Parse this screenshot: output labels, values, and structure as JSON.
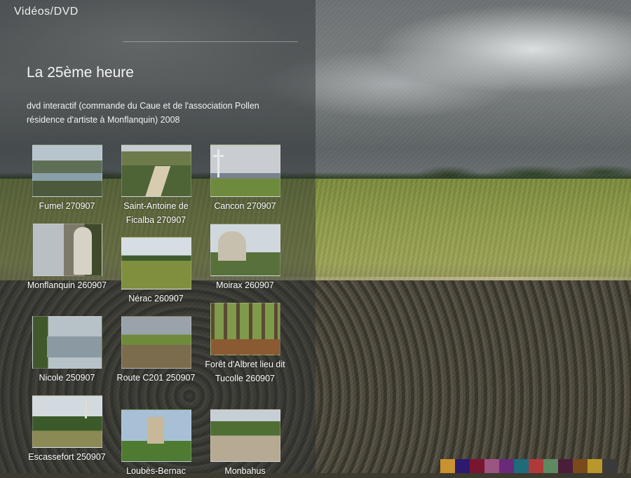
{
  "section": {
    "title": "Vidéos/DVD"
  },
  "page": {
    "title": "La 25ème heure",
    "description": "dvd interactif (commande du Caue et de l'association Pollen résidence d'artiste à Monflanquin) 2008"
  },
  "thumbnails": [
    {
      "caption": "Fumel 270907"
    },
    {
      "caption": "Saint-Antoine de Ficalba 270907"
    },
    {
      "caption": "Cancon 270907"
    },
    {
      "caption": "Monflanquin 260907"
    },
    {
      "caption": "Nérac 260907"
    },
    {
      "caption": "Moirax 260907"
    },
    {
      "caption": "Nicole 250907"
    },
    {
      "caption": "Route C201 250907"
    },
    {
      "caption": "Forêt d'Albret lieu dit Tucolle 260907"
    },
    {
      "caption": "Escassefort 250907"
    },
    {
      "caption": "Loubès-Bernac"
    },
    {
      "caption": "Monbahus"
    }
  ],
  "palette": [
    "#c8922f",
    "#2c1a6e",
    "#7a1530",
    "#9a5580",
    "#6a2a7a",
    "#1e6b7a",
    "#b03a3a",
    "#5f8a60",
    "#4a1e3a",
    "#7a4a1a",
    "#b8982a",
    "#3a3a3a"
  ]
}
